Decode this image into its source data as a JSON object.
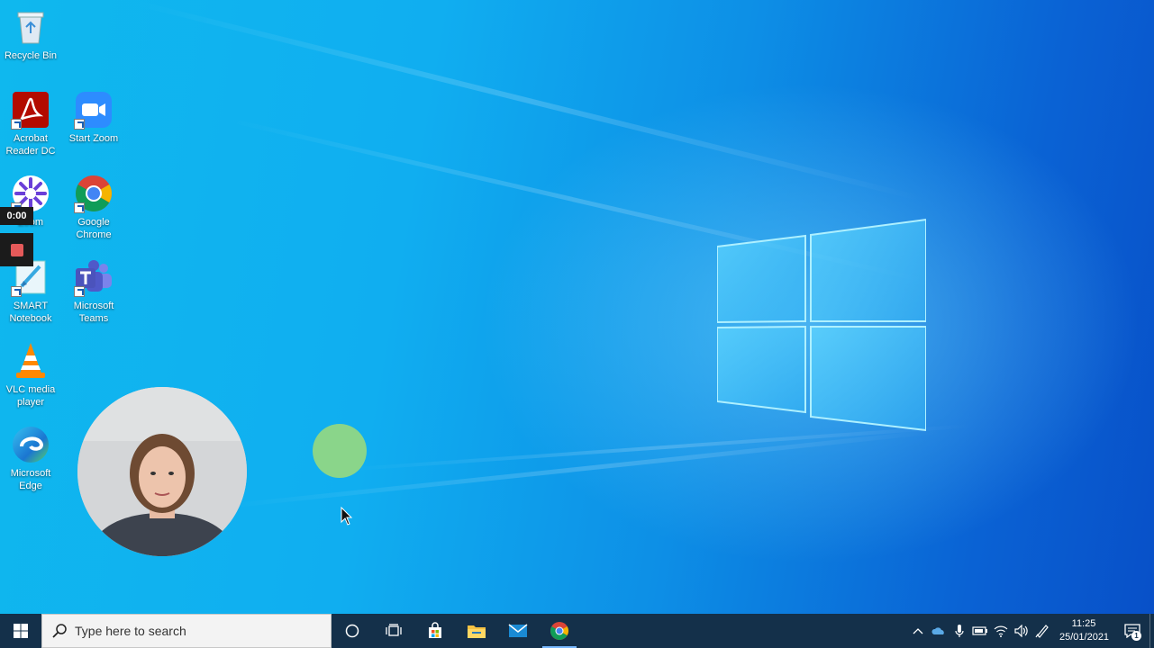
{
  "desktop": {
    "icons": [
      {
        "id": "recycle-bin",
        "label": "Recycle Bin",
        "icon": "recycle-bin-icon"
      },
      {
        "id": "acrobat",
        "label": "Acrobat Reader DC",
        "icon": "acrobat-reader-icon"
      },
      {
        "id": "start-zoom",
        "label": "Start Zoom",
        "icon": "zoom-icon"
      },
      {
        "id": "zoom",
        "label": "Zoom",
        "icon": "zoom-flower-icon"
      },
      {
        "id": "google-chrome",
        "label": "Google Chrome",
        "icon": "chrome-icon"
      },
      {
        "id": "smart-notebook",
        "label": "SMART Notebook",
        "icon": "smart-notebook-icon"
      },
      {
        "id": "microsoft-teams",
        "label": "Microsoft Teams",
        "icon": "teams-icon"
      },
      {
        "id": "vlc",
        "label": "VLC media player",
        "icon": "vlc-icon"
      },
      {
        "id": "microsoft-edge",
        "label": "Microsoft Edge",
        "icon": "edge-icon"
      }
    ]
  },
  "recorder": {
    "timer": "0:00",
    "stop_icon": "stop-record-icon"
  },
  "taskbar": {
    "search_placeholder": "Type here to search",
    "pinned": [
      "cortana-icon",
      "task-view-icon",
      "microsoft-store-icon",
      "file-explorer-icon",
      "mail-icon",
      "chrome-icon"
    ],
    "active_app": "chrome-icon"
  },
  "tray": {
    "icons": [
      "show-hidden-icons-chevron",
      "onedrive-icon",
      "microphone-icon",
      "battery-icon",
      "wifi-icon",
      "volume-icon",
      "pen-icon"
    ],
    "time": "11:25",
    "date": "25/01/2021",
    "notification_count": "1"
  },
  "colors": {
    "taskbar_bg": "#14304a",
    "desktop_blue": "#10aef0",
    "accent": "#78b8ff"
  }
}
